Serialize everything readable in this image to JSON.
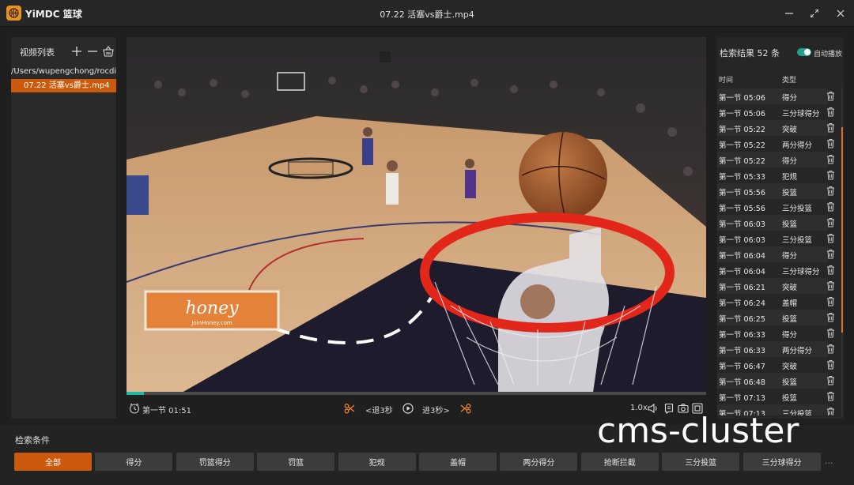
{
  "app": {
    "name": "YiMDC 篮球",
    "window_title": "07.22 活塞vs爵士.mp4"
  },
  "left_panel": {
    "title": "视频列表",
    "path": "/Users/wupengchong/rocdi...",
    "files": [
      "07.22 活塞vs爵士.mp4"
    ]
  },
  "video": {
    "ad_text": "honey",
    "ad_subtext": "JoinHoney.com",
    "progress": 0.03
  },
  "controls": {
    "time_label": "第一节 01:51",
    "back_label": "<退3秒",
    "forward_label": "进3秒>",
    "speed": "1.0x"
  },
  "results": {
    "title": "检索结果 52 条",
    "autoplay_label": "自动播放",
    "autoplay_on": true,
    "col_time": "时间",
    "col_type": "类型",
    "rows": [
      {
        "time": "第一节 05:06",
        "type": "得分"
      },
      {
        "time": "第一节 05:06",
        "type": "三分球得分"
      },
      {
        "time": "第一节 05:22",
        "type": "突破"
      },
      {
        "time": "第一节 05:22",
        "type": "两分得分"
      },
      {
        "time": "第一节 05:22",
        "type": "得分"
      },
      {
        "time": "第一节 05:33",
        "type": "犯规"
      },
      {
        "time": "第一节 05:56",
        "type": "投篮"
      },
      {
        "time": "第一节 05:56",
        "type": "三分投篮"
      },
      {
        "time": "第一节 06:03",
        "type": "投篮"
      },
      {
        "time": "第一节 06:03",
        "type": "三分投篮"
      },
      {
        "time": "第一节 06:04",
        "type": "得分"
      },
      {
        "time": "第一节 06:04",
        "type": "三分球得分"
      },
      {
        "time": "第一节 06:21",
        "type": "突破"
      },
      {
        "time": "第一节 06:24",
        "type": "盖帽"
      },
      {
        "time": "第一节 06:25",
        "type": "投篮"
      },
      {
        "time": "第一节 06:33",
        "type": "得分"
      },
      {
        "time": "第一节 06:33",
        "type": "两分得分"
      },
      {
        "time": "第一节 06:47",
        "type": "突破"
      },
      {
        "time": "第一节 06:48",
        "type": "投篮"
      },
      {
        "time": "第一节 07:13",
        "type": "投篮"
      },
      {
        "time": "第一节 07:13",
        "type": "三分投篮"
      }
    ]
  },
  "filters": {
    "title": "检索条件",
    "chips": [
      "全部",
      "得分",
      "罚篮得分",
      "罚篮",
      "犯规",
      "盖帽",
      "两分得分",
      "抢断拦截",
      "三分投篮",
      "三分球得分"
    ],
    "active_index": 0
  },
  "watermark": "cms-cluster",
  "colors": {
    "accent": "#cc5a0c",
    "toggle": "#22a08c",
    "progress": "#1fb6a6"
  }
}
